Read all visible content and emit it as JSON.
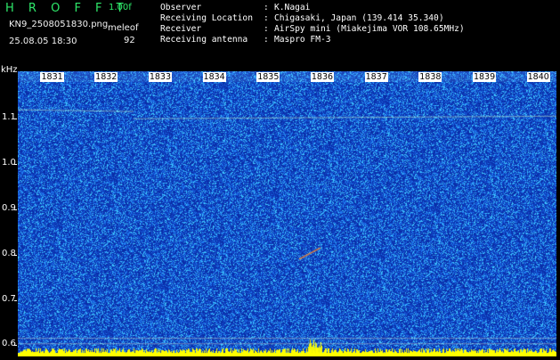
{
  "header": {
    "brand": "H R O F F T",
    "version": "1.00f",
    "filename": "KN9_2508051830.png",
    "meleo_label": "meleof",
    "datetime": "25.08.05 18:30",
    "count": "92"
  },
  "info": [
    {
      "label": "Observer",
      "value": "K.Nagai"
    },
    {
      "label": "Receiving Location",
      "value": "Chigasaki, Japan (139.414 35.340)"
    },
    {
      "label": "Receiver",
      "value": "AirSpy mini (Miakejima VOR 108.65MHz)"
    },
    {
      "label": "Receiving antenna",
      "value": "Maspro FM-3"
    }
  ],
  "axis": {
    "y_unit": "kHz",
    "y_ticks": [
      "1.1",
      "1.0",
      "0.9",
      "0.8",
      "0.7",
      "0.6"
    ],
    "y_values": [
      1.1,
      1.0,
      0.9,
      0.8,
      0.7,
      0.6
    ],
    "y_range": [
      0.575,
      1.205
    ],
    "time_ticks": [
      "1831",
      "1832",
      "1833",
      "1834",
      "1835",
      "1836",
      "1837",
      "1838",
      "1839",
      "1840"
    ],
    "time_range": [
      1830.58,
      1840.55
    ]
  },
  "colors": {
    "background": "#000000",
    "spectrogram_base": "#0a2ea8",
    "noise_light": "#3fc8ff",
    "noise_mid": "#1f7cf0",
    "signal": "#ffff00",
    "brand": "#2ee86a"
  }
}
